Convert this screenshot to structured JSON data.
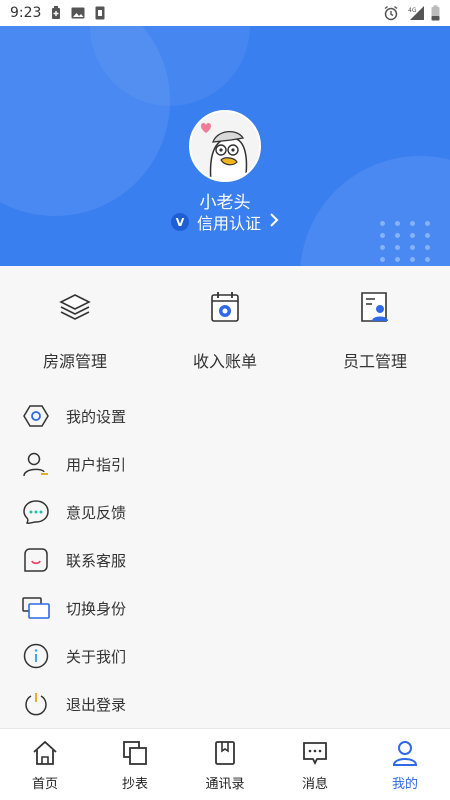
{
  "status_bar": {
    "time": "9:23",
    "network": "4G"
  },
  "profile": {
    "username": "小老头",
    "verify_badge": "V",
    "verify_label": "信用认证"
  },
  "quick_actions": [
    {
      "label": "房源管理",
      "icon": "stack-layers-icon"
    },
    {
      "label": "收入账单",
      "icon": "calendar-bill-icon"
    },
    {
      "label": "员工管理",
      "icon": "employee-card-icon"
    }
  ],
  "menu": [
    {
      "label": "我的设置",
      "icon": "settings-hexagon-icon"
    },
    {
      "label": "用户指引",
      "icon": "user-guide-icon"
    },
    {
      "label": "意见反馈",
      "icon": "feedback-bubble-icon"
    },
    {
      "label": "联系客服",
      "icon": "smile-bubble-icon"
    },
    {
      "label": "切换身份",
      "icon": "switch-identity-icon"
    },
    {
      "label": "关于我们",
      "icon": "info-icon"
    },
    {
      "label": "退出登录",
      "icon": "power-icon"
    }
  ],
  "tabs": [
    {
      "label": "首页",
      "icon": "home-icon"
    },
    {
      "label": "抄表",
      "icon": "meter-icon"
    },
    {
      "label": "通讯录",
      "icon": "contacts-icon"
    },
    {
      "label": "消息",
      "icon": "message-icon"
    },
    {
      "label": "我的",
      "icon": "profile-icon",
      "active": true
    }
  ],
  "colors": {
    "primary": "#3a7ff0",
    "active_tab": "#2f6ae6"
  }
}
